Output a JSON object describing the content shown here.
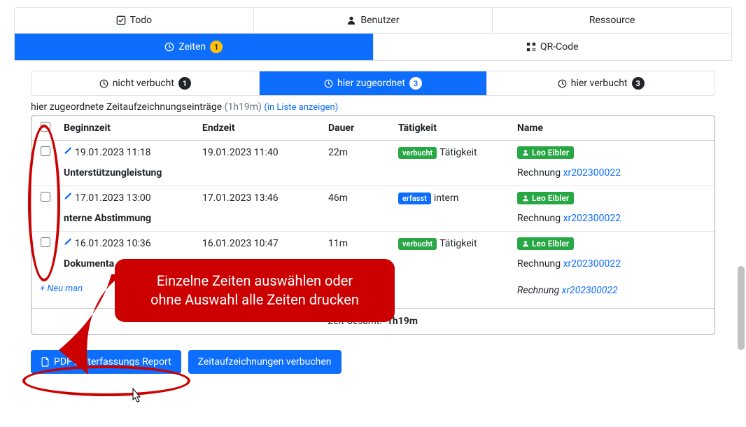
{
  "mainTabs": {
    "todo": "Todo",
    "benutzer": "Benutzer",
    "ressource": "Ressource",
    "zeiten": "Zeiten",
    "zeitenBadge": "1",
    "qrcode": "QR-Code"
  },
  "subTabs": {
    "unbooked": "nicht verbucht",
    "unbookedBadge": "1",
    "assigned": "hier zugeordnet",
    "assignedBadge": "3",
    "booked": "hier verbucht",
    "bookedBadge": "3"
  },
  "caption": {
    "text": "hier zugeordnete Zeitaufzeichnungseinträge",
    "duration": "(1h19m)",
    "link": "(in Liste anzeigen)"
  },
  "headers": {
    "begin": "Beginnzeit",
    "end": "Endzeit",
    "dur": "Dauer",
    "act": "Tätigkeit",
    "name": "Name"
  },
  "rows": [
    {
      "begin": "19.01.2023 11:18",
      "end": "19.01.2023 11:40",
      "dur": "22m",
      "status": "verbucht",
      "statusClass": "bg-green",
      "act": "Tätigkeit",
      "user": "Leo Eibler",
      "title": "Unterstützungleistung",
      "rechLabel": "Rechnung",
      "rechNo": "xr202300022"
    },
    {
      "begin": "17.01.2023 13:00",
      "end": "17.01.2023 13:46",
      "dur": "46m",
      "status": "erfasst",
      "statusClass": "bg-blue",
      "act": "intern",
      "user": "Leo Eibler",
      "title": "nterne Abstimmung",
      "rechLabel": "Rechnung",
      "rechNo": "xr202300022"
    },
    {
      "begin": "16.01.2023 10:36",
      "end": "16.01.2023 10:47",
      "dur": "11m",
      "status": "verbucht",
      "statusClass": "bg-green",
      "act": "Tätigkeit",
      "user": "Leo Eibler",
      "title": "Dokumenta",
      "rechLabel": "Rechnung",
      "rechNo": "xr202300022"
    }
  ],
  "newLabel": "+ Neu man",
  "lastRech": {
    "label": "Rechnung",
    "no": "xr202300022"
  },
  "total": {
    "label": "Zeit Gesamt:",
    "value": "1h19m"
  },
  "buttons": {
    "pdf": "PDF Zeiterfassungs Report",
    "book": "Zeitaufzeichnungen verbuchen"
  },
  "annotation": {
    "line1": "Einzelne Zeiten auswählen oder",
    "line2": "ohne Auswahl alle Zeiten drucken"
  }
}
